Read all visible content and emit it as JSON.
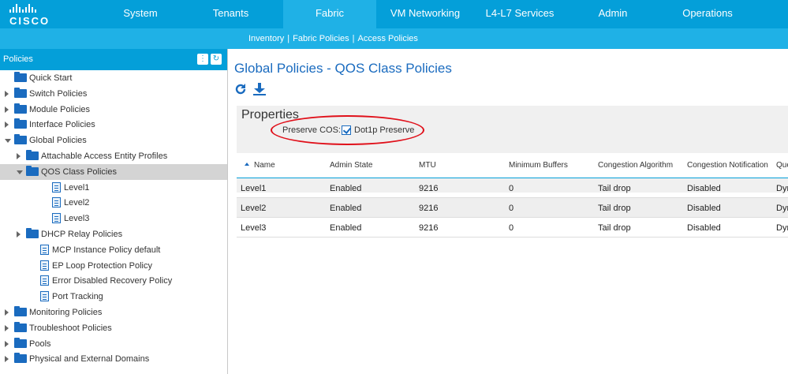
{
  "brand": {
    "logo_text": "CISCO"
  },
  "nav": {
    "items": [
      {
        "label": "System"
      },
      {
        "label": "Tenants"
      },
      {
        "label": "Fabric"
      },
      {
        "label": "VM Networking"
      },
      {
        "label": "L4-L7 Services"
      },
      {
        "label": "Admin"
      },
      {
        "label": "Operations"
      }
    ],
    "active": "Fabric"
  },
  "breadcrumb": [
    "Inventory",
    "Fabric Policies",
    "Access Policies"
  ],
  "left_panel": {
    "title": "Policies",
    "tree": [
      {
        "label": "Quick Start",
        "level": 0,
        "icon": "folder-icon",
        "arrow": "none"
      },
      {
        "label": "Switch Policies",
        "level": 0,
        "icon": "folder-icon",
        "arrow": "right"
      },
      {
        "label": "Module Policies",
        "level": 0,
        "icon": "folder-icon",
        "arrow": "right"
      },
      {
        "label": "Interface Policies",
        "level": 0,
        "icon": "folder-icon",
        "arrow": "right"
      },
      {
        "label": "Global Policies",
        "level": 0,
        "icon": "folder-icon",
        "arrow": "down"
      },
      {
        "label": "Attachable Access Entity Profiles",
        "level": 1,
        "icon": "folder-icon",
        "arrow": "right"
      },
      {
        "label": "QOS Class Policies",
        "level": 1,
        "icon": "folder-icon",
        "arrow": "down",
        "selected": true
      },
      {
        "label": "Level1",
        "level": 2,
        "icon": "policy-doc-icon",
        "arrow": "none"
      },
      {
        "label": "Level2",
        "level": 2,
        "icon": "policy-doc-icon",
        "arrow": "none"
      },
      {
        "label": "Level3",
        "level": 2,
        "icon": "policy-doc-icon",
        "arrow": "none"
      },
      {
        "label": "DHCP Relay Policies",
        "level": 1,
        "icon": "folder-icon",
        "arrow": "right"
      },
      {
        "label": "MCP Instance Policy default",
        "level": 1,
        "icon": "policy-doc-icon",
        "arrow": "none"
      },
      {
        "label": "EP Loop Protection Policy",
        "level": 1,
        "icon": "policy-doc-icon",
        "arrow": "none"
      },
      {
        "label": "Error Disabled Recovery Policy",
        "level": 1,
        "icon": "policy-doc-icon",
        "arrow": "none"
      },
      {
        "label": "Port Tracking",
        "level": 1,
        "icon": "policy-doc-icon",
        "arrow": "none"
      },
      {
        "label": "Monitoring Policies",
        "level": 0,
        "icon": "folder-icon",
        "arrow": "right"
      },
      {
        "label": "Troubleshoot Policies",
        "level": 0,
        "icon": "folder-icon",
        "arrow": "right"
      },
      {
        "label": "Pools",
        "level": 0,
        "icon": "folder-icon",
        "arrow": "right"
      },
      {
        "label": "Physical and External Domains",
        "level": 0,
        "icon": "folder-icon",
        "arrow": "right"
      }
    ]
  },
  "main": {
    "title": "Global Policies - QOS Class Policies",
    "toolbar": [
      "refresh-icon",
      "download-icon"
    ],
    "properties": {
      "title": "Properties",
      "preserve_cos_label": "Preserve COS:",
      "preserve_cos_option": "Dot1p Preserve",
      "preserve_cos_checked": true
    },
    "table": {
      "columns": [
        "Name",
        "Admin State",
        "MTU",
        "Minimum Buffers",
        "Congestion Algorithm",
        "Congestion Notification",
        "Que"
      ],
      "rows": [
        [
          "Level1",
          "Enabled",
          "9216",
          "0",
          "Tail drop",
          "Disabled",
          "Dyn"
        ],
        [
          "Level2",
          "Enabled",
          "9216",
          "0",
          "Tail drop",
          "Disabled",
          "Dyn"
        ],
        [
          "Level3",
          "Enabled",
          "9216",
          "0",
          "Tail drop",
          "Disabled",
          "Dyn"
        ]
      ]
    }
  },
  "colors": {
    "brand_blue": "#049fd9",
    "sub_blue": "#1fb1e6",
    "title_blue": "#1a6bbf",
    "annotation_red": "#e0101a"
  }
}
